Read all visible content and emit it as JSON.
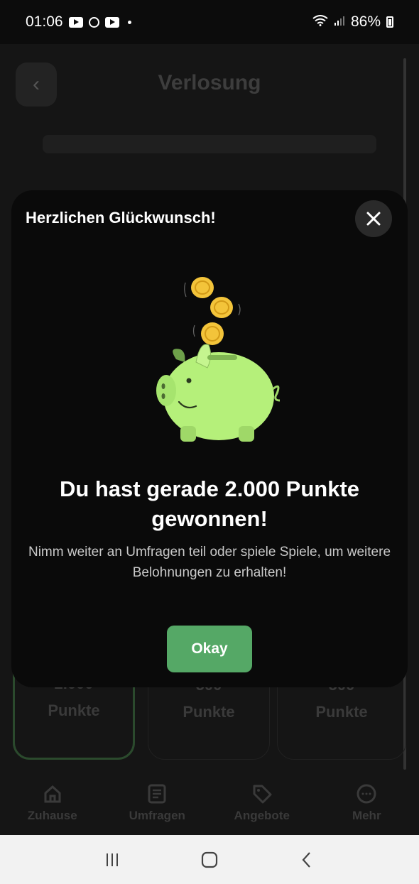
{
  "status_bar": {
    "time": "01:06",
    "battery": "86%"
  },
  "background": {
    "title": "Verlosung",
    "cards": [
      {
        "value": "2.000",
        "unit": "Punkte"
      },
      {
        "value": "500",
        "unit": "Punkte"
      },
      {
        "value": "500",
        "unit": "Punkte"
      }
    ],
    "nav": [
      {
        "label": "Zuhause",
        "icon": "home-icon"
      },
      {
        "label": "Umfragen",
        "icon": "survey-icon"
      },
      {
        "label": "Angebote",
        "icon": "tag-icon"
      },
      {
        "label": "Mehr",
        "icon": "more-icon"
      }
    ]
  },
  "modal": {
    "title": "Herzlichen Glückwunsch!",
    "headline": "Du hast gerade 2.000 Punkte gewonnen!",
    "body": "Nimm weiter an Umfragen teil oder spiele Spiele, um weitere Belohnungen zu erhalten!",
    "button_label": "Okay",
    "illustration": "piggy-bank-with-coins",
    "accent_color": "#55a866",
    "pig_color": "#b5f07a"
  }
}
